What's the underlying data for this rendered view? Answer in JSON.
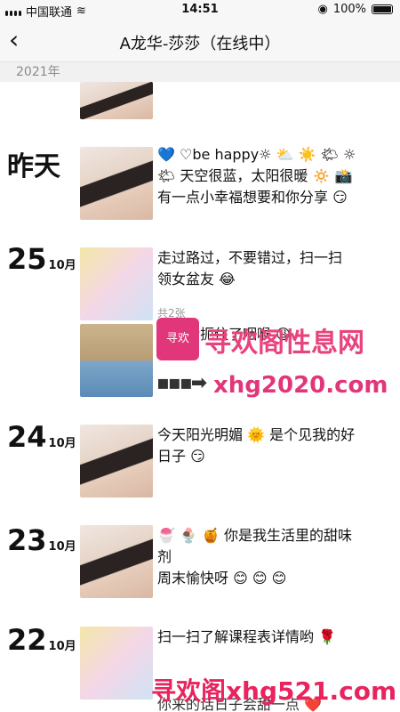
{
  "status_bar": {
    "carrier": "中国联通",
    "time": "14:51",
    "battery": "100%"
  },
  "header": {
    "title": "A龙华-莎莎（在线中）"
  },
  "year_label": "2021年",
  "posts": [
    {
      "day": "昨天",
      "text": "💙 ♡be happy☼ ⛅ ☀️ 🌤 ☼\n🌤 天空很蓝，太阳很暖 🔅 📸\n有一点小幸福想要和你分享 😏"
    },
    {
      "day": "25",
      "month": "10月",
      "text": "走过路过，不要错过，扫一扫\n领女盆友 😂",
      "count": "共2张",
      "text2": "被生活扼住了咽喉 😩"
    },
    {
      "day": "24",
      "month": "10月",
      "text": "今天阳光明媚 🌞 是个见我的好\n日子 😏"
    },
    {
      "day": "23",
      "month": "10月",
      "text": "🍧 🍨 🍯 你是我生活里的甜味\n剂\n周末愉快呀 😊 😊 😊"
    },
    {
      "day": "22",
      "month": "10月",
      "text": "扫一扫了解课程表详情哟 🌹",
      "text2": "你来的话日子会甜一点 ❤️"
    }
  ],
  "watermarks": {
    "badge": "寻欢",
    "title": "寻欢阁性息网",
    "url": "xhg2020.com",
    "arrow": "▪▪▪➡",
    "bottom": "寻欢阁xhg521.com"
  }
}
